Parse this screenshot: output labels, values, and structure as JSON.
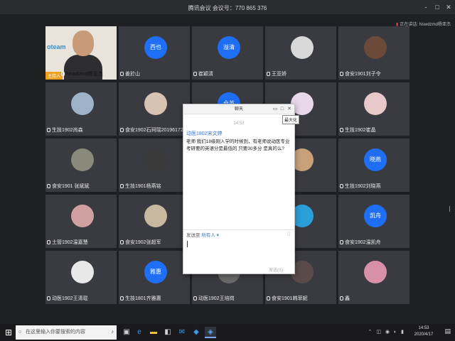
{
  "window": {
    "title": "腾讯会议 会议号：770 865 376",
    "controls": [
      "-",
      "□",
      "✕"
    ]
  },
  "speaker": {
    "label": "正在讲话: Nswdzmd杨亚杰"
  },
  "participants": [
    {
      "name": "Nswdzmd杨亚杰",
      "type": "video",
      "badge": "主持人",
      "logo": "oteam"
    },
    {
      "name": "姜於山",
      "type": "blue",
      "initials": "西也"
    },
    {
      "name": "崔颖清",
      "type": "blue",
      "initials": "溢清"
    },
    {
      "name": "王亚娇",
      "type": "photo",
      "color": "#d8d8d8"
    },
    {
      "name": "食安1901刘子令",
      "type": "photo",
      "color": "#6b4a3a"
    },
    {
      "name": "生技1902尚森",
      "type": "photo",
      "color": "#9fb3c8"
    },
    {
      "name": "食安1902石珂瑶20196172",
      "type": "photo",
      "color": "#d8c3b3"
    },
    {
      "name": "",
      "type": "blue",
      "initials": "仓英"
    },
    {
      "name": "",
      "type": "photo",
      "color": "#e8d8e8"
    },
    {
      "name": "生技1902崔晶",
      "type": "photo",
      "color": "#e8c8c8"
    },
    {
      "name": "食安1901 张斌斌",
      "type": "photo",
      "color": "#8a8a7a"
    },
    {
      "name": "生技1901杨燕铭",
      "type": "photo",
      "color": "#3a3a3a"
    },
    {
      "name": "",
      "type": "photo",
      "color": "#c9c4bb"
    },
    {
      "name": "",
      "type": "photo",
      "color": "#c8a07a"
    },
    {
      "name": "生技1902刘晓燕",
      "type": "blue",
      "initials": "晓燕"
    },
    {
      "name": "土管1902温嘉慧",
      "type": "photo",
      "color": "#d0a0a0"
    },
    {
      "name": "食安1902张超军",
      "type": "photo",
      "color": "#c8b8a0"
    },
    {
      "name": "",
      "type": "photo",
      "color": "#b0b0b0"
    },
    {
      "name": "",
      "type": "photo",
      "color": "#2a9fd8"
    },
    {
      "name": "食安1902温凯舟",
      "type": "blue",
      "initials": "凯舟"
    },
    {
      "name": "动医1902王清琨",
      "type": "photo",
      "color": "#e8e8e8"
    },
    {
      "name": "生技1801齐雅惠",
      "type": "blue",
      "initials": "雅惠"
    },
    {
      "name": "动医1902王培岗",
      "type": "photo",
      "color": "#6a6a6a"
    },
    {
      "name": "食安1901韩菲妮",
      "type": "photo",
      "color": "#5a4a4a"
    },
    {
      "name": "鑫",
      "type": "photo",
      "color": "#d890a8"
    }
  ],
  "chat": {
    "title": "聊天",
    "time": "14:53",
    "sender": "动医1802宋文婷",
    "message": "老师 我们18级刚入学的时候到，有老师说动医专业考研要的英语分是最低的 只要30多分 是真的么?",
    "send_to_label": "发送至",
    "send_to_target": "所有人",
    "send_button": "发送(S)",
    "maximize_tooltip": "最大化"
  },
  "taskbar": {
    "search_placeholder": "在这里输入你要搜索的内容",
    "time": "14:53",
    "date": "2020/4/17"
  }
}
